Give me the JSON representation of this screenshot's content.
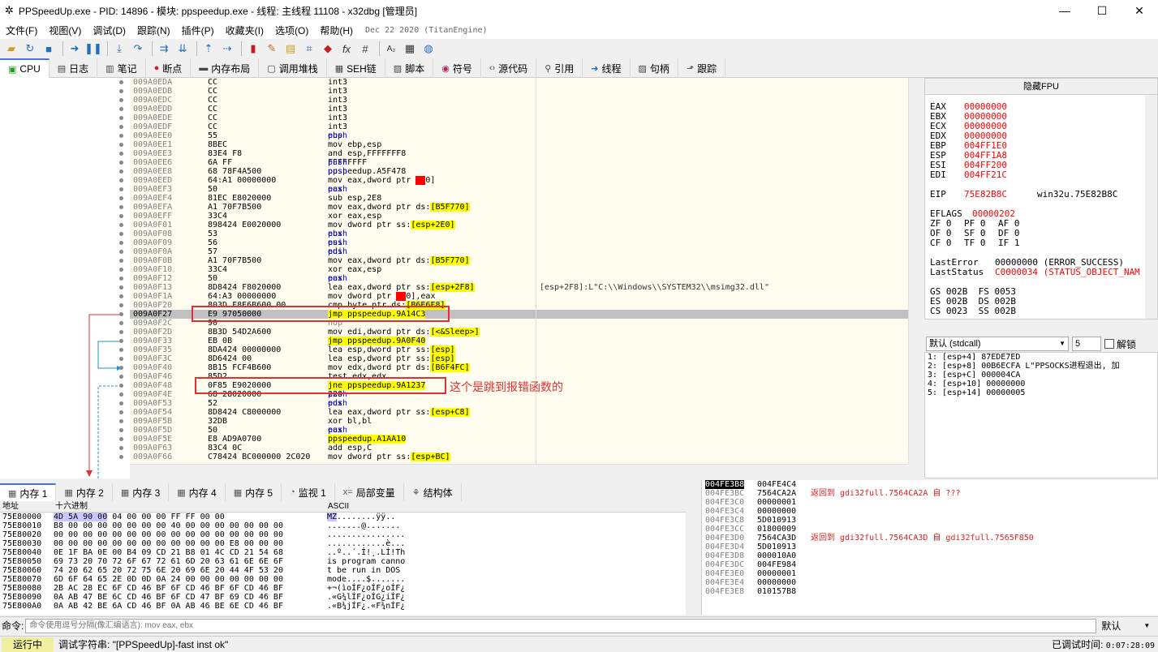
{
  "window": {
    "title": "PPSpeedUp.exe - PID: 14896 - 模块: ppspeedup.exe - 线程: 主线程 11108 - x32dbg [管理员]"
  },
  "menu": {
    "items": [
      "文件(F)",
      "视图(V)",
      "调试(D)",
      "跟踪(N)",
      "插件(P)",
      "收藏夹(I)",
      "选项(O)",
      "帮助(H)"
    ],
    "date": "Dec 22 2020 (TitanEngine)"
  },
  "tabs": [
    {
      "label": "CPU",
      "icon": "cpu-icon"
    },
    {
      "label": "日志",
      "icon": "log-icon"
    },
    {
      "label": "笔记",
      "icon": "notes-icon"
    },
    {
      "label": "断点",
      "icon": "breakpoint-icon"
    },
    {
      "label": "内存布局",
      "icon": "memory-map-icon"
    },
    {
      "label": "调用堆栈",
      "icon": "callstack-icon"
    },
    {
      "label": "SEH链",
      "icon": "seh-icon"
    },
    {
      "label": "脚本",
      "icon": "script-icon"
    },
    {
      "label": "符号",
      "icon": "symbol-icon"
    },
    {
      "label": "源代码",
      "icon": "source-icon"
    },
    {
      "label": "引用",
      "icon": "reference-icon"
    },
    {
      "label": "线程",
      "icon": "thread-icon"
    },
    {
      "label": "句柄",
      "icon": "handle-icon"
    },
    {
      "label": "跟踪",
      "icon": "trace-icon"
    }
  ],
  "disasm": [
    {
      "addr": "009A0EDA",
      "bytes": "CC",
      "ins": "int3",
      "cmt": ""
    },
    {
      "addr": "009A0EDB",
      "bytes": "CC",
      "ins": "int3",
      "cmt": ""
    },
    {
      "addr": "009A0EDC",
      "bytes": "CC",
      "ins": "int3",
      "cmt": ""
    },
    {
      "addr": "009A0EDD",
      "bytes": "CC",
      "ins": "int3",
      "cmt": ""
    },
    {
      "addr": "009A0EDE",
      "bytes": "CC",
      "ins": "int3",
      "cmt": ""
    },
    {
      "addr": "009A0EDF",
      "bytes": "CC",
      "ins": "int3",
      "cmt": ""
    },
    {
      "addr": "009A0EE0",
      "bytes": "55",
      "ins": "push ebp",
      "cmt": ""
    },
    {
      "addr": "009A0EE1",
      "bytes": "8BEC",
      "ins": "mov ebp,esp",
      "cmt": ""
    },
    {
      "addr": "009A0EE3",
      "bytes": "83E4 F8",
      "ins": "and esp,FFFFFFF8",
      "cmt": ""
    },
    {
      "addr": "009A0EE6",
      "bytes": "6A FF",
      "ins": "push FFFFFFFF",
      "cmt": ""
    },
    {
      "addr": "009A0EE8",
      "bytes": "68 78F4A500",
      "ins": "push ppspeedup.A5F478",
      "cmt": ""
    },
    {
      "addr": "009A0EED",
      "bytes": "64:A1 00000000",
      "ins": "mov eax,dword ptr fs:[0]",
      "cmt": ""
    },
    {
      "addr": "009A0EF3",
      "bytes": "50",
      "ins": "push eax",
      "cmt": ""
    },
    {
      "addr": "009A0EF4",
      "bytes": "81EC E8020000",
      "ins": "sub esp,2E8",
      "cmt": ""
    },
    {
      "addr": "009A0EFA",
      "bytes": "A1 70F7B500",
      "ins": "mov eax,dword ptr ds:[B5F770]",
      "cmt": ""
    },
    {
      "addr": "009A0EFF",
      "bytes": "33C4",
      "ins": "xor eax,esp",
      "cmt": ""
    },
    {
      "addr": "009A0F01",
      "bytes": "898424 E0020000",
      "ins": "mov dword ptr ss:[esp+2E0],eax",
      "cmt": ""
    },
    {
      "addr": "009A0F08",
      "bytes": "53",
      "ins": "push ebx",
      "cmt": ""
    },
    {
      "addr": "009A0F09",
      "bytes": "56",
      "ins": "push esi",
      "cmt": ""
    },
    {
      "addr": "009A0F0A",
      "bytes": "57",
      "ins": "push edi",
      "cmt": ""
    },
    {
      "addr": "009A0F0B",
      "bytes": "A1 70F7B500",
      "ins": "mov eax,dword ptr ds:[B5F770]",
      "cmt": ""
    },
    {
      "addr": "009A0F10",
      "bytes": "33C4",
      "ins": "xor eax,esp",
      "cmt": ""
    },
    {
      "addr": "009A0F12",
      "bytes": "50",
      "ins": "push eax",
      "cmt": ""
    },
    {
      "addr": "009A0F13",
      "bytes": "8D8424 F8020000",
      "ins": "lea eax,dword ptr ss:[esp+2F8]",
      "cmt": "[esp+2F8]:L\"C:\\\\Windows\\\\SYSTEM32\\\\msimg32.dll\""
    },
    {
      "addr": "009A0F1A",
      "bytes": "64:A3 00000000",
      "ins": "mov dword ptr fs:[0],eax",
      "cmt": ""
    },
    {
      "addr": "009A0F20",
      "bytes": "803D F8E6B600 00",
      "ins": "cmp byte ptr ds:[B6E6F8],0",
      "cmt": ""
    },
    {
      "addr": "009A0F27",
      "bytes": "E9 97050000",
      "ins": "jmp ppspeedup.9A14C3",
      "cmt": ""
    },
    {
      "addr": "009A0F2C",
      "bytes": "90",
      "ins": "nop",
      "cmt": ""
    },
    {
      "addr": "009A0F2D",
      "bytes": "8B3D 54D2A600",
      "ins": "mov edi,dword ptr ds:[<&Sleep>]",
      "cmt": ""
    },
    {
      "addr": "009A0F33",
      "bytes": "EB 0B",
      "ins": "jmp ppspeedup.9A0F40",
      "cmt": ""
    },
    {
      "addr": "009A0F35",
      "bytes": "8DA424 00000000",
      "ins": "lea esp,dword ptr ss:[esp]",
      "cmt": ""
    },
    {
      "addr": "009A0F3C",
      "bytes": "8D6424 00",
      "ins": "lea esp,dword ptr ss:[esp]",
      "cmt": ""
    },
    {
      "addr": "009A0F40",
      "bytes": "8B15 FCF4B600",
      "ins": "mov edx,dword ptr ds:[B6F4FC]",
      "cmt": ""
    },
    {
      "addr": "009A0F46",
      "bytes": "85D2",
      "ins": "test edx,edx",
      "cmt": ""
    },
    {
      "addr": "009A0F48",
      "bytes": "0F85 E9020000",
      "ins": "jne ppspeedup.9A1237",
      "cmt": ""
    },
    {
      "addr": "009A0F4E",
      "bytes": "68 28020000",
      "ins": "push 228",
      "cmt": ""
    },
    {
      "addr": "009A0F53",
      "bytes": "52",
      "ins": "push edx",
      "cmt": ""
    },
    {
      "addr": "009A0F54",
      "bytes": "8D8424 C8000000",
      "ins": "lea eax,dword ptr ss:[esp+C8]",
      "cmt": ""
    },
    {
      "addr": "009A0F5B",
      "bytes": "32DB",
      "ins": "xor bl,bl",
      "cmt": ""
    },
    {
      "addr": "009A0F5D",
      "bytes": "50",
      "ins": "push eax",
      "cmt": ""
    },
    {
      "addr": "009A0F5E",
      "bytes": "E8 AD9A0700",
      "ins": "call ppspeedup.A1AA10",
      "cmt": ""
    },
    {
      "addr": "009A0F63",
      "bytes": "83C4 0C",
      "ins": "add esp,C",
      "cmt": ""
    },
    {
      "addr": "009A0F66",
      "bytes": "C78424 BC000000 2C020",
      "ins": "mov dword ptr ss:[esp+BC],22C",
      "cmt": ""
    }
  ],
  "annotation": {
    "text": "这个是跳到报错函数的"
  },
  "fpu": {
    "hide_label": "隐藏FPU"
  },
  "registers": [
    {
      "name": "EAX",
      "value": "00000000"
    },
    {
      "name": "EBX",
      "value": "00000000"
    },
    {
      "name": "ECX",
      "value": "00000000"
    },
    {
      "name": "EDX",
      "value": "00000000"
    },
    {
      "name": "EBP",
      "value": "004FF1E0"
    },
    {
      "name": "ESP",
      "value": "004FF1A8"
    },
    {
      "name": "ESI",
      "value": "004FF200"
    },
    {
      "name": "EDI",
      "value": "004FF21C"
    }
  ],
  "eip": {
    "name": "EIP",
    "value": "75E82B8C",
    "sym": "win32u.75E82B8C"
  },
  "eflags": {
    "name": "EFLAGS",
    "value": "00000202"
  },
  "flags": [
    [
      "ZF 0",
      "PF 0",
      "AF 0"
    ],
    [
      "OF 0",
      "SF 0",
      "DF 0"
    ],
    [
      "CF 0",
      "TF 0",
      "IF 1"
    ]
  ],
  "lasterror": {
    "name": "LastError",
    "value": "00000000 (ERROR_SUCCESS)"
  },
  "laststatus": {
    "name": "LastStatus",
    "value": "C0000034 (STATUS_OBJECT_NAM"
  },
  "segs": [
    "GS 002B  FS 0053",
    "ES 002B  DS 002B",
    "CS 0023  SS 002B"
  ],
  "callconv": {
    "label": "默认 (stdcall)",
    "count": "5",
    "unlock": "解锁"
  },
  "stackargs": [
    "1: [esp+4] 87EDE7ED",
    "2: [esp+8] 00B6ECFA L\"PPSOCKS进程退出, 加",
    "3: [esp+C] 000004CA",
    "4: [esp+10] 00000000",
    "5: [esp+14] 00000005"
  ],
  "bottom_tabs": [
    {
      "label": "内存 1",
      "icon": "memory-icon"
    },
    {
      "label": "内存 2",
      "icon": "memory-icon"
    },
    {
      "label": "内存 3",
      "icon": "memory-icon"
    },
    {
      "label": "内存 4",
      "icon": "memory-icon"
    },
    {
      "label": "内存 5",
      "icon": "memory-icon"
    },
    {
      "label": "监视 1",
      "icon": "watch-icon"
    },
    {
      "label": "局部变量",
      "icon": "locals-icon"
    },
    {
      "label": "结构体",
      "icon": "struct-icon"
    }
  ],
  "memhdr": {
    "addr": "地址",
    "hex": "十六进制",
    "ascii": "ASCII"
  },
  "memdump": [
    {
      "addr": "75E80000",
      "hex": "4D 5A 90 00 03 00 00 00 04 00 00 00 FF FF 00 00",
      "ascii": "MZ..........ÿÿ.."
    },
    {
      "addr": "75E80010",
      "hex": "B8 00 00 00 00 00 00 00 40 00 00 00 00 00 00 00",
      "ascii": ".......@......."
    },
    {
      "addr": "75E80020",
      "hex": "00 00 00 00 00 00 00 00 00 00 00 00 00 00 00 00",
      "ascii": "................"
    },
    {
      "addr": "75E80030",
      "hex": "00 00 00 00 00 00 00 00 00 00 00 00 E8 00 00 00",
      "ascii": "............è..."
    },
    {
      "addr": "75E80040",
      "hex": "0E 1F BA 0E 00 B4 09 CD 21 B8 01 4C CD 21 54 68",
      "ascii": "..º..´.Í!¸.LÍ!Th"
    },
    {
      "addr": "75E80050",
      "hex": "69 73 20 70 72 6F 67 72 61 6D 20 63 61 6E 6E 6F",
      "ascii": "is program canno"
    },
    {
      "addr": "75E80060",
      "hex": "74 20 62 65 20 72 75 6E 20 69 6E 20 44 4F 53 20",
      "ascii": "t be run in DOS "
    },
    {
      "addr": "75E80070",
      "hex": "6D 6F 64 65 2E 0D 0D 0A 24 00 00 00 00 00 00 00",
      "ascii": "mode....$......."
    },
    {
      "addr": "75E80080",
      "hex": "2B AC 28 EC 6F CD 46 BF 6F CD 46 BF 6F CD 46 BF",
      "ascii": "+¬(ìoÍF¿oÍF¿oÍF¿"
    },
    {
      "addr": "75E80090",
      "hex": "0A AB 47 BE 6C CD 46 BF 6F CD 47 BF 69 CD 46 BF",
      "ascii": ".«G¾lÍF¿oÍG¿iÍF¿"
    },
    {
      "addr": "75E800A0",
      "hex": "0A AB 42 BE 6A CD 46 BF 0A AB 46 BE 6E CD 46 BF",
      "ascii": ".«B¾jÍF¿.«F¾nÍF¿"
    }
  ],
  "stack2": [
    {
      "addr": "004FE3B8",
      "val": "004FE4C4",
      "cmt": "",
      "cur": true
    },
    {
      "addr": "004FE3BC",
      "val": "7564CA2A",
      "cmt": "返回到 gdi32full.7564CA2A 自 ???"
    },
    {
      "addr": "004FE3C0",
      "val": "00000001",
      "cmt": ""
    },
    {
      "addr": "004FE3C4",
      "val": "00000000",
      "cmt": ""
    },
    {
      "addr": "004FE3C8",
      "val": "5D010913",
      "cmt": ""
    },
    {
      "addr": "004FE3CC",
      "val": "01800009",
      "cmt": ""
    },
    {
      "addr": "004FE3D0",
      "val": "7564CA3D",
      "cmt": "返回到 gdi32full.7564CA3D 自 gdi32full.7565F850"
    },
    {
      "addr": "004FE3D4",
      "val": "5D010913",
      "cmt": ""
    },
    {
      "addr": "004FE3D8",
      "val": "000010A0",
      "cmt": ""
    },
    {
      "addr": "004FE3DC",
      "val": "004FE984",
      "cmt": ""
    },
    {
      "addr": "004FE3E0",
      "val": "00000001",
      "cmt": ""
    },
    {
      "addr": "004FE3E4",
      "val": "00000000",
      "cmt": ""
    },
    {
      "addr": "004FE3E8",
      "val": "010157B8",
      "cmt": ""
    }
  ],
  "cmd": {
    "label": "命令:",
    "placeholder": "命令使用逗号分隔(像汇编语言): mov eax, ebx",
    "default": "默认"
  },
  "status": {
    "state": "运行中",
    "message": "调试字符串: \"[PPSpeedUp]-fast inst ok\"",
    "time_label": "已调试时间:",
    "time": "0:07:28:09"
  }
}
